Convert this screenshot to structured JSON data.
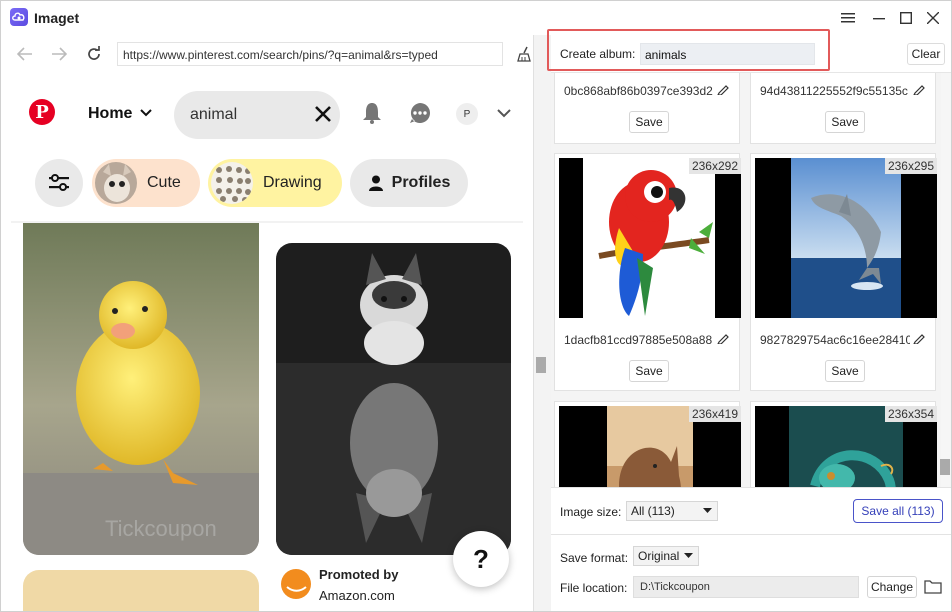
{
  "app": {
    "title": "Imaget"
  },
  "window_controls": {
    "menu_icon": "hamburger-icon",
    "minimize_icon": "minimize-icon",
    "maximize_icon": "maximize-icon",
    "close_icon": "close-icon"
  },
  "browser": {
    "url": "https://www.pinterest.com/search/pins/?q=animal&rs=typed",
    "icons": [
      "back-arrow-icon",
      "forward-arrow-icon",
      "reload-icon",
      "broom-clear-icon"
    ]
  },
  "pinterest": {
    "logo": "P",
    "home_label": "Home",
    "search_value": "animal",
    "avatar_initial": "P",
    "chips": [
      {
        "label": "Cute"
      },
      {
        "label": "Drawing"
      },
      {
        "label": "Profiles"
      }
    ],
    "promoted": {
      "title": "Promoted by",
      "subtitle": "Amazon.com"
    },
    "help_label": "?",
    "watermark": "Tickcoupon"
  },
  "album": {
    "label": "Create album:",
    "value": "animals",
    "clear_label": "Clear"
  },
  "gallery": {
    "cards": [
      {
        "name": "0bc868abf86b0397ce393d2",
        "save": "Save"
      },
      {
        "name": "94d43811225552f9c55135c",
        "save": "Save"
      },
      {
        "name": "1dacfb81ccd97885e508a88",
        "dims": "236x292",
        "save": "Save"
      },
      {
        "name": "9827829754ac6c16ee28410",
        "dims": "236x295",
        "save": "Save"
      },
      {
        "dims": "236x419"
      },
      {
        "dims": "236x354"
      }
    ]
  },
  "bottom": {
    "image_size_label": "Image size:",
    "image_size_value": "All (113)",
    "save_all_label": "Save all (113)",
    "save_format_label": "Save format:",
    "save_format_value": "Original",
    "file_location_label": "File location:",
    "file_location_value": "D:\\Tickcoupon",
    "change_label": "Change"
  },
  "colors": {
    "accent": "#3540b9",
    "pinterest_red": "#e60023",
    "highlight": "#e25a5a"
  }
}
